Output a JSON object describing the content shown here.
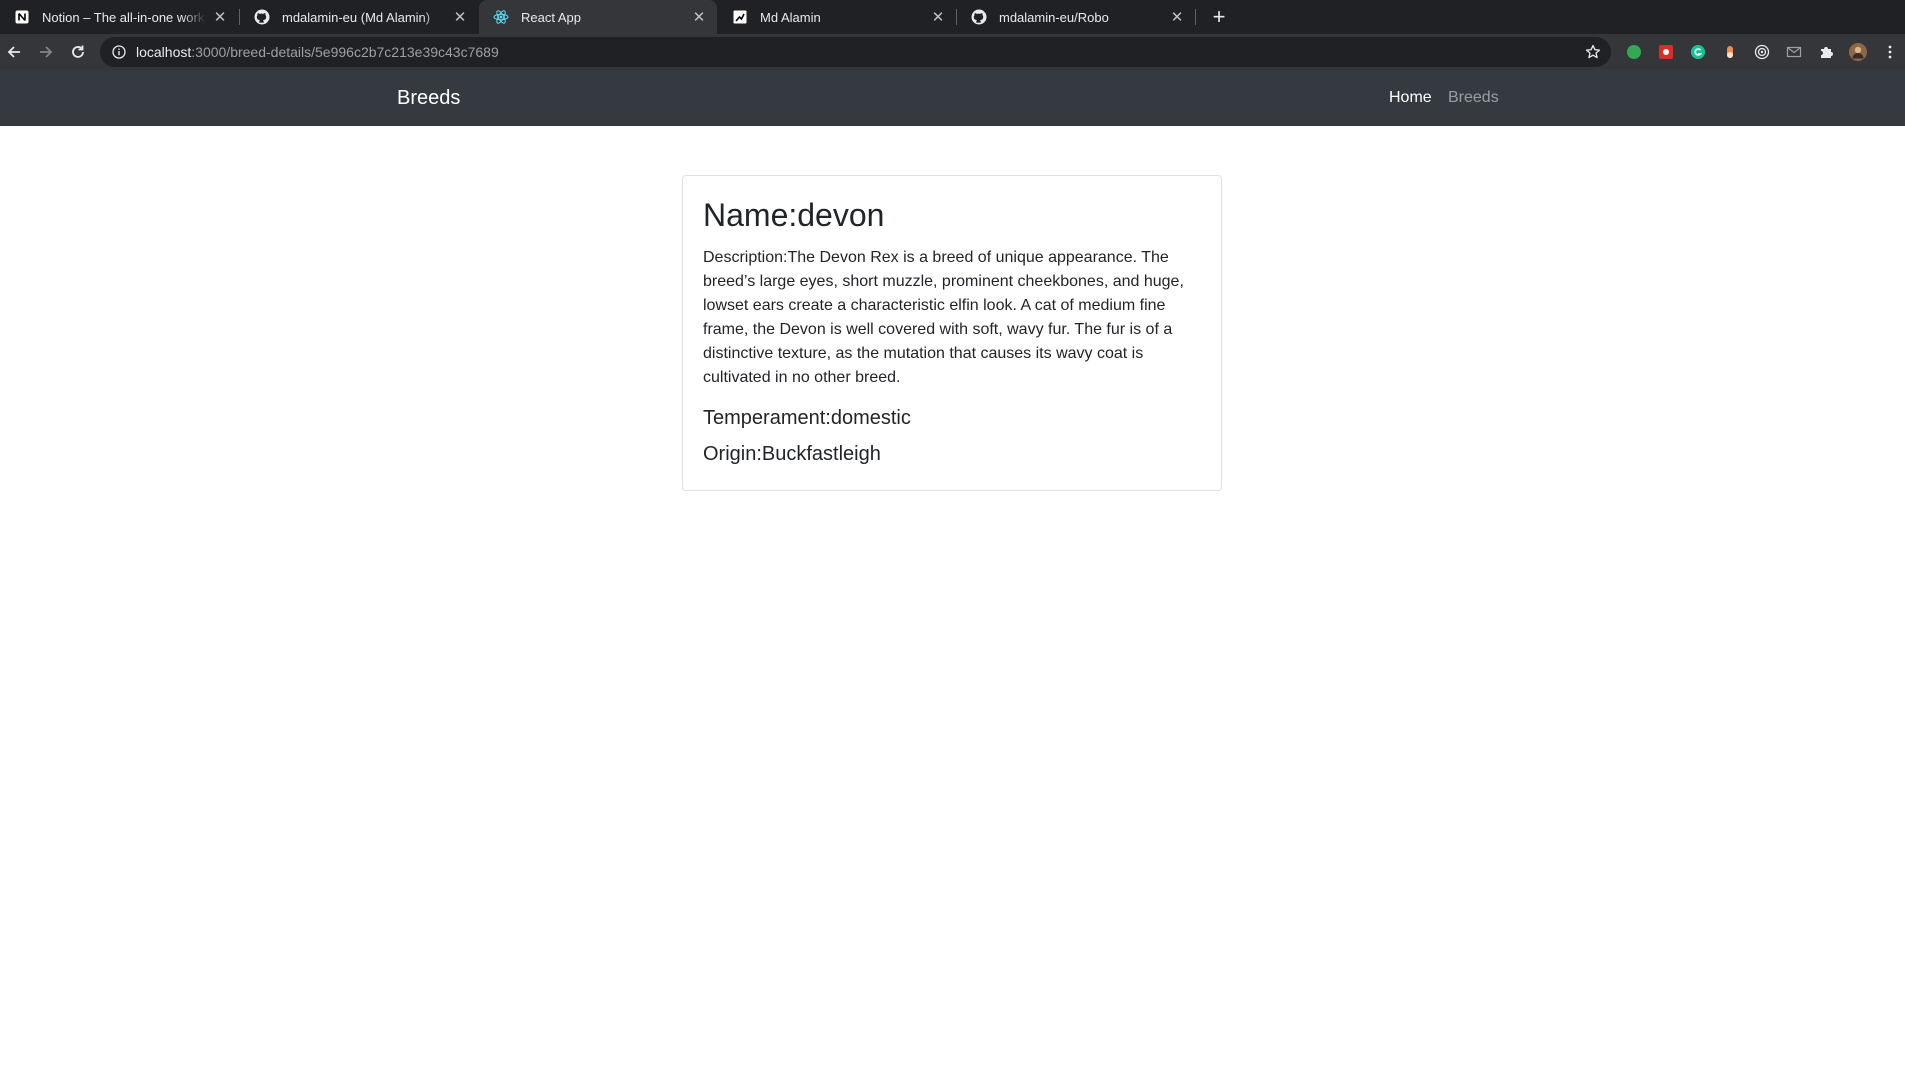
{
  "browser": {
    "tabs": [
      {
        "title": "Notion – The all-in-one workspace",
        "icon": "notion-icon",
        "active": false
      },
      {
        "title": "mdalamin-eu (Md Alamin)",
        "icon": "github-icon",
        "active": false
      },
      {
        "title": "React App",
        "icon": "react-icon",
        "active": true
      },
      {
        "title": "Md Alamin",
        "icon": "portfolio-icon",
        "active": false
      },
      {
        "title": "mdalamin-eu/Robo",
        "icon": "github-icon",
        "active": false
      }
    ],
    "close_glyph": "✕",
    "new_tab_glyph": "+",
    "url_host": "localhost",
    "url_rest": ":3000/breed-details/5e996c2b7c213e39c43c7689"
  },
  "navbar": {
    "brand": "Breeds",
    "links": [
      {
        "label": "Home",
        "active": true
      },
      {
        "label": "Breeds",
        "active": false
      }
    ]
  },
  "breed": {
    "name_label": "Name:devon",
    "description": "Description:The Devon Rex is a breed of unique appearance. The breed’s large eyes, short muzzle, prominent cheekbones, and huge, lowset ears create a characteristic elfin look. A cat of medium fine frame, the Devon is well covered with soft, wavy fur. The fur is of a distinctive texture, as the mutation that causes its wavy coat is cultivated in no other breed.",
    "temperament": "Temperament:domestic",
    "origin": "Origin:Buckfastleigh"
  },
  "colors": {
    "navbar_bg": "#343a40",
    "chrome_dark": "#202124",
    "chrome_toolbar": "#35363a"
  }
}
